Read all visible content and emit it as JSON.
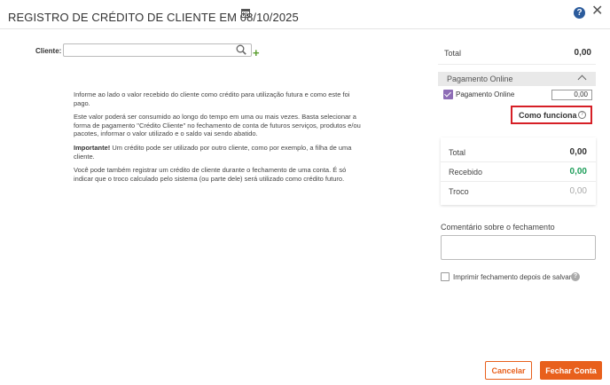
{
  "header": {
    "title": "REGISTRO DE CRÉDITO DE CLIENTE EM 08/10/2025",
    "icons": {
      "calendar": "calendar-icon",
      "help": "help-icon",
      "close": "close-icon"
    },
    "help_glyph": "?",
    "close_glyph": "✕"
  },
  "cliente": {
    "label": "Cliente:",
    "value": "",
    "add_glyph": "+"
  },
  "info": {
    "p1": "Informe ao lado o valor recebido do cliente como crédito para utilização futura e como este foi pago.",
    "p2": "Este valor poderá ser consumido ao longo do tempo em uma ou mais vezes. Basta selecionar a forma de pagamento \"Crédito Cliente\" no fechamento de conta de futuros serviços, produtos e/ou pacotes, informar o valor utilizado e o saldo vai sendo abatido.",
    "p3_bold": "Importante!",
    "p3_rest": " Um crédito pode ser utilizado por outro cliente, como por exemplo, a filha de uma cliente.",
    "p4": "Você pode também registrar um crédito de cliente durante o fechamento de uma conta. É só indicar que o troco calculado pelo sistema (ou parte dele) será utilizado como crédito futuro."
  },
  "total_top": {
    "label": "Total",
    "value": "0,00"
  },
  "pagamento_online": {
    "header": "Pagamento Online",
    "checkbox_label": "Pagamento Online",
    "checked": true,
    "amount": "0,00",
    "como_funciona": "Como funciona",
    "help_glyph": "?"
  },
  "summary": {
    "rows": [
      {
        "label": "Total",
        "value": "0,00"
      },
      {
        "label": "Recebido",
        "value": "0,00"
      },
      {
        "label": "Troco",
        "value": "0,00"
      }
    ],
    "colors": {
      "recebido": "#1e9e5a",
      "troco": "#aaaaaa"
    }
  },
  "comentario": {
    "label": "Comentário sobre o fechamento",
    "value": ""
  },
  "print": {
    "label": "Imprimir fechamento depois de salvar",
    "checked": false,
    "help_glyph": "?"
  },
  "buttons": {
    "cancel": "Cancelar",
    "close_account": "Fechar Conta"
  },
  "colors": {
    "accent": "#e8601c",
    "checkbox": "#8e6db6",
    "highlight_border": "#d61f26",
    "help_blue": "#2b5b9c"
  }
}
